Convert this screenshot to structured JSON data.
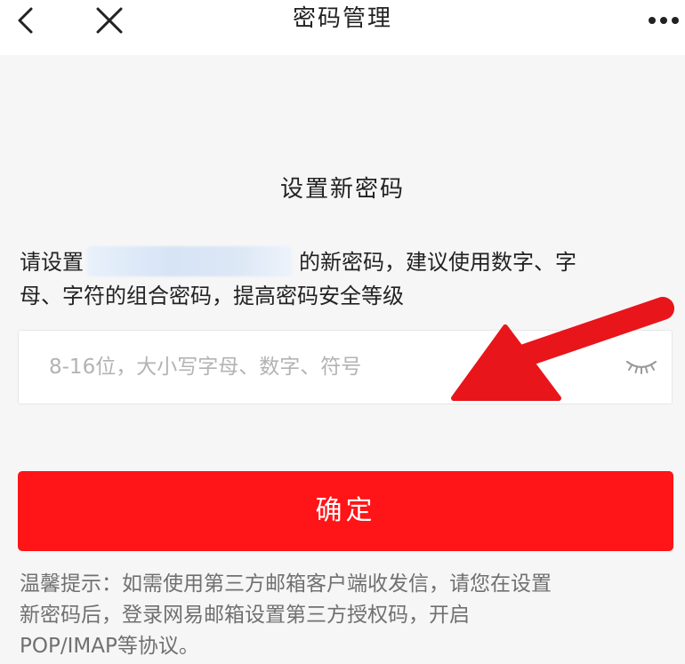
{
  "header": {
    "title": "密码管理"
  },
  "main": {
    "heading": "设置新密码",
    "desc_before": "请设置",
    "desc_after": "的新密码，建议使用数字、字",
    "desc_line2": "母、字符的组合密码，提高密码安全等级",
    "password_placeholder": "8-16位，大小写字母、数字、符号",
    "password_value": "",
    "confirm_label": "确定"
  },
  "tips": {
    "line1": "温馨提示：如需使用第三方邮箱客户端收发信，请您在设置",
    "line2": "新密码后，登录网易邮箱设置第三方授权码，开启",
    "line3": "POP/IMAP等协议。"
  },
  "icons": {
    "back": "chevron-left-icon",
    "close": "close-icon",
    "more": "more-horizontal-icon",
    "eye": "eye-closed-icon"
  },
  "colors": {
    "primary": "#ff1418",
    "annotation_arrow": "#e8151b",
    "background": "#f6f6f6",
    "placeholder": "#b3b3b3",
    "tips": "#707070"
  }
}
